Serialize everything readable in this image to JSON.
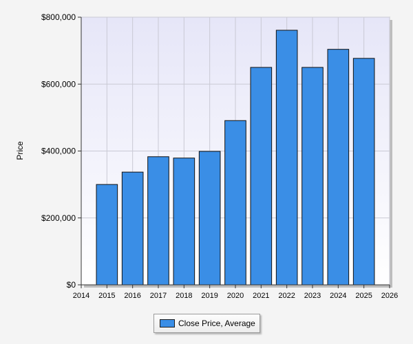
{
  "chart_data": {
    "type": "bar",
    "ylabel": "Price",
    "xlabel": "",
    "title": "",
    "categories": [
      "2015",
      "2016",
      "2017",
      "2018",
      "2019",
      "2020",
      "2021",
      "2022",
      "2023",
      "2024",
      "2025"
    ],
    "series": [
      {
        "name": "Close Price, Average",
        "values": [
          300000,
          337000,
          383000,
          379000,
          399000,
          491000,
          650000,
          761000,
          650000,
          704000,
          677000
        ]
      }
    ],
    "xlim": [
      2014,
      2026
    ],
    "x_ticks": [
      "2014",
      "2015",
      "2016",
      "2017",
      "2018",
      "2019",
      "2020",
      "2021",
      "2022",
      "2023",
      "2024",
      "2025",
      "2026"
    ],
    "ylim": [
      0,
      800000
    ],
    "y_ticks": [
      "$0",
      "$200,000",
      "$400,000",
      "$600,000",
      "$800,000"
    ],
    "grid": true,
    "legend_position": "bottom-center",
    "colors": {
      "bar": "#3a8ee6",
      "bar_edge": "#111111"
    }
  }
}
